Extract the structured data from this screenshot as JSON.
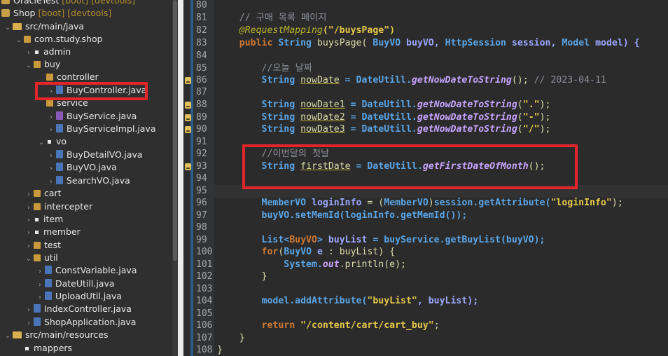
{
  "tree": {
    "items": [
      {
        "label": "OracleTest",
        "tag": "[boot] [devtools]"
      },
      {
        "label": "Shop",
        "tag": "[boot] [devtools]"
      },
      {
        "label": "src/main/java"
      },
      {
        "label": "com.study.shop"
      },
      {
        "label": "admin"
      },
      {
        "label": "buy"
      },
      {
        "label": "controller"
      },
      {
        "label": "BuyController.java"
      },
      {
        "label": "service"
      },
      {
        "label": "BuyService.java"
      },
      {
        "label": "BuyServiceImpl.java"
      },
      {
        "label": "vo"
      },
      {
        "label": "BuyDetailVO.java"
      },
      {
        "label": "BuyVO.java"
      },
      {
        "label": "SearchVO.java"
      },
      {
        "label": "cart"
      },
      {
        "label": "intercepter"
      },
      {
        "label": "item"
      },
      {
        "label": "member"
      },
      {
        "label": "test"
      },
      {
        "label": "util"
      },
      {
        "label": "ConstVariable.java"
      },
      {
        "label": "DateUtill.java"
      },
      {
        "label": "UploadUtil.java"
      },
      {
        "label": "IndexController.java"
      },
      {
        "label": "ShopApplication.java"
      },
      {
        "label": "src/main/resources"
      },
      {
        "label": "mappers"
      }
    ]
  },
  "editor": {
    "line_numbers": [
      "80",
      "81",
      "82",
      "83",
      "84",
      "85",
      "86",
      "87",
      "88",
      "89",
      "90",
      "91",
      "92",
      "93",
      "94",
      "95",
      "96",
      "97",
      "98",
      "99",
      "100",
      "101",
      "102",
      "103",
      "104",
      "105",
      "106",
      "107",
      "108"
    ],
    "l81": "// 구매 목록 페이지",
    "l82_ann": "@RequestMapping",
    "l82_str": "(\"/buysPage\")",
    "l83_public": "public",
    "l83_string": "String",
    "l83_name": "buysPage(",
    "l83_buyvo": "BuyVO",
    "l83_buyvo_var": "buyVO,",
    "l83_session_type": "HttpSession",
    "l83_session": "session,",
    "l83_model_type": "Model",
    "l83_model": "model) {",
    "l85": "//오늘 날짜",
    "l86_type": "String",
    "l86_var": "nowDate",
    "l86_rest": " = DateUtill.",
    "l86_method": "getNowDateToString",
    "l86_end": "(); ",
    "l86_cmt": "// 2023-04-11",
    "l88_var": "nowDate1",
    "l88_arg": "\".\"",
    "l89_var": "nowDate2",
    "l89_arg": "\"-\"",
    "l90_var": "nowDate3",
    "l90_arg": "\"/\"",
    "l92": "//이번달의 첫날",
    "l93_var": "firstDate",
    "l93_method": "getFirstDateOfMonth",
    "l96_type": "MemberVO",
    "l96_var": "loginInfo",
    "l96_cast": "MemberVO",
    "l96_rest": "session.getAttribute(",
    "l96_str": "\"loginInfo\"",
    "l97": "buyVO.setMemId(loginInfo.getMemId());",
    "l99_list": "List<",
    "l99_type": "BuyVO",
    "l99_var": "buyList",
    "l99_rest": " = buyService.getBuyList(buyVO);",
    "l100_for": "for",
    "l100_type": "BuyVO",
    "l100_var": "e",
    "l100_rest": " : buyList) {",
    "l101_sys": "System.",
    "l101_out": "out",
    "l101_rest": ".println(e);",
    "l102": "}",
    "l104_rest": "model.addAttribute(",
    "l104_str": "\"buyList\"",
    "l104_end": ", buyList);",
    "l106_kw": "return",
    "l106_str": "\"/content/cart/cart_buy\"",
    "l107": "}",
    "l108": "}"
  }
}
